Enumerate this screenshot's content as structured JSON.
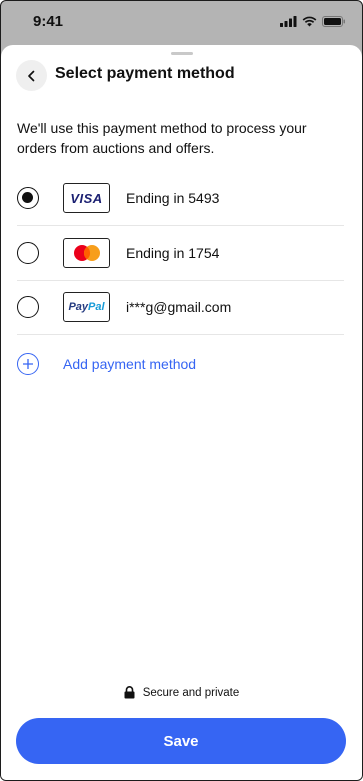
{
  "status_bar": {
    "time": "9:41"
  },
  "header": {
    "title": "Select payment method"
  },
  "description": "We'll use this payment method to process your orders from auctions and offers.",
  "payment_methods": [
    {
      "brand": "VISA",
      "label": "Ending in 5493",
      "selected": true
    },
    {
      "brand": "Mastercard",
      "label": "Ending in 1754",
      "selected": false
    },
    {
      "brand_pay": "Pay",
      "brand_pal": "Pal",
      "label": "i***g@gmail.com",
      "selected": false
    }
  ],
  "add_payment_label": "Add payment method",
  "secure_text": "Secure and private",
  "save_label": "Save",
  "colors": {
    "accent": "#3665f3",
    "visa_blue": "#1a1f71",
    "mastercard_red": "#eb001b",
    "mastercard_orange": "#f79e1b",
    "paypal_dark": "#253b80",
    "paypal_light": "#179bd7"
  },
  "icons": [
    "back-arrow-icon",
    "lock-icon",
    "plus-circle-icon",
    "signal-icon",
    "wifi-icon",
    "battery-icon"
  ]
}
